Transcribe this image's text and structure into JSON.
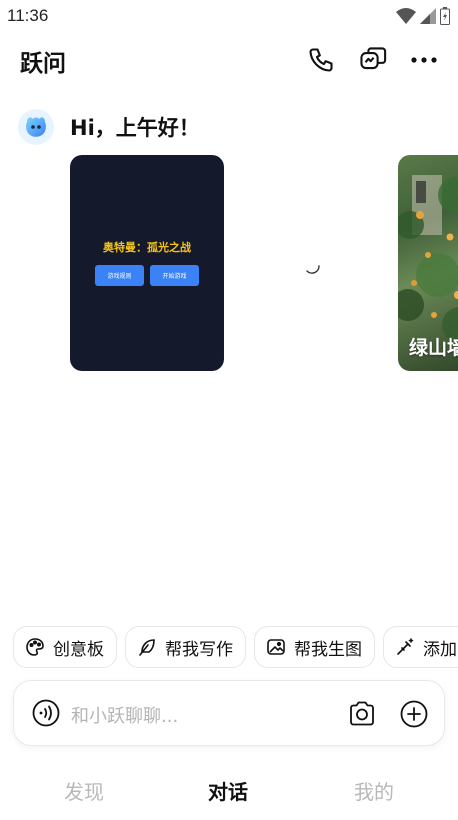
{
  "status_bar": {
    "time": "11:36",
    "icons": [
      "wifi-icon",
      "signal-icon",
      "battery-icon"
    ]
  },
  "header": {
    "title": "跃问",
    "actions": [
      "phone-icon",
      "chat-switch-icon",
      "more-icon"
    ]
  },
  "greeting": {
    "text": "Hi，上午好！"
  },
  "cards": {
    "game": {
      "title": "奥特曼：孤光之战",
      "rules_button": "游戏规则",
      "start_button": "开始游戏",
      "accent": "#f3c21b",
      "background": "#141a2b"
    },
    "photo": {
      "label": "绿山墙"
    }
  },
  "quick_actions": [
    {
      "label": "创意板",
      "icon": "creative-board-icon"
    },
    {
      "label": "帮我写作",
      "icon": "feather-pen-icon"
    },
    {
      "label": "帮我生图",
      "icon": "image-icon"
    },
    {
      "label": "添加",
      "icon": "magic-wand-icon"
    }
  ],
  "composer": {
    "placeholder": "和小跃聊聊..."
  },
  "tabs": [
    {
      "label": "发现",
      "active": false
    },
    {
      "label": "对话",
      "active": true
    },
    {
      "label": "我的",
      "active": false
    }
  ],
  "colors": {
    "primary_text": "#111111",
    "muted_text": "#b9b9b9",
    "button_blue": "#3b82f6"
  }
}
